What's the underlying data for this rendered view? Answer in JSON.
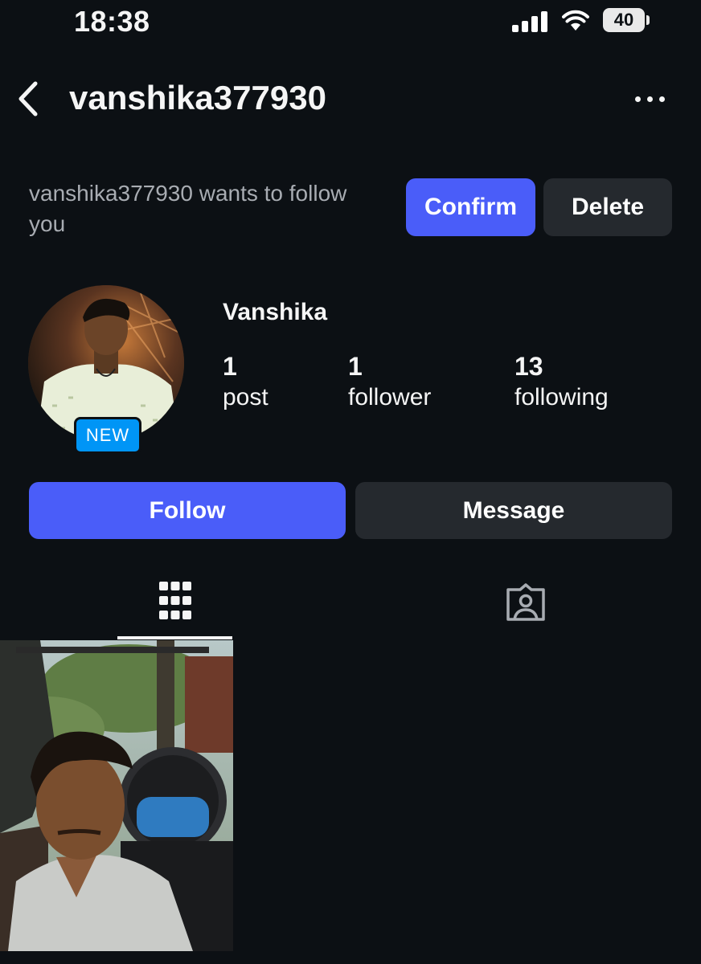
{
  "status_bar": {
    "time": "18:38",
    "battery": "40"
  },
  "header": {
    "username": "vanshika377930"
  },
  "follow_request": {
    "text": "vanshika377930 wants to follow you",
    "confirm_label": "Confirm",
    "delete_label": "Delete"
  },
  "profile": {
    "display_name": "Vanshika",
    "badge": "NEW",
    "stats": [
      {
        "value": "1",
        "label": "post"
      },
      {
        "value": "1",
        "label": "follower"
      },
      {
        "value": "13",
        "label": "following"
      }
    ]
  },
  "actions": {
    "follow_label": "Follow",
    "message_label": "Message"
  },
  "tabs": [
    {
      "icon": "grid-icon",
      "active": true
    },
    {
      "icon": "tagged-person-icon",
      "active": false
    }
  ],
  "colors": {
    "background": "#0c1014",
    "accent": "#4a5df9",
    "secondary_button": "#25292e",
    "badge": "#0095f6"
  }
}
